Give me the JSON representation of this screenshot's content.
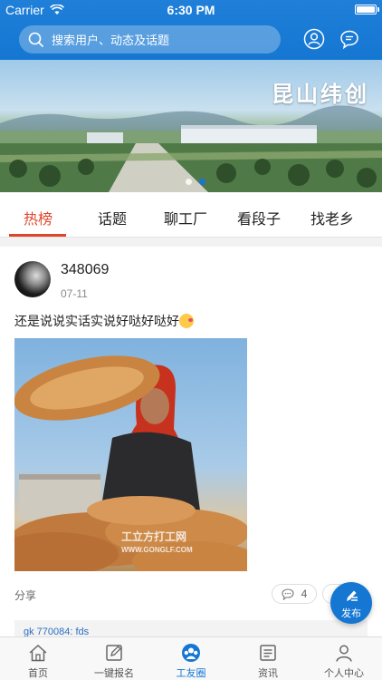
{
  "status_bar": {
    "carrier": "Carrier",
    "time": "6:30 PM"
  },
  "header": {
    "search_placeholder": "搜索用户、动态及话题",
    "icons": [
      "search-icon",
      "user-icon",
      "message-icon"
    ],
    "bg_color": "#1577d2"
  },
  "banner": {
    "title": "昆山纬创",
    "pages": 2,
    "active_page": 2
  },
  "tabs": [
    {
      "label": "热榜",
      "active": true
    },
    {
      "label": "话题",
      "active": false
    },
    {
      "label": "聊工厂",
      "active": false
    },
    {
      "label": "看段子",
      "active": false
    },
    {
      "label": "找老乡",
      "active": false
    }
  ],
  "post": {
    "username": "348069",
    "date": "07-11",
    "text": "还是说说实话实说好哒好哒好",
    "image_watermark": "工立方打工网",
    "image_watermark_url": "WWW.GONGLF.COM",
    "share_label": "分享",
    "comment_count": "4",
    "comment_preview": "gk 770084: fds"
  },
  "fab": {
    "label": "发布",
    "icon": "pencil-icon"
  },
  "bottom_nav": [
    {
      "label": "首页",
      "icon": "home-icon",
      "active": false
    },
    {
      "label": "一键报名",
      "icon": "edit-icon",
      "active": false
    },
    {
      "label": "工友圈",
      "icon": "community-icon",
      "active": true
    },
    {
      "label": "资讯",
      "icon": "news-icon",
      "active": false
    },
    {
      "label": "个人中心",
      "icon": "profile-icon",
      "active": false
    }
  ],
  "colors": {
    "accent": "#1577d2",
    "tab_active": "#e0452b"
  }
}
